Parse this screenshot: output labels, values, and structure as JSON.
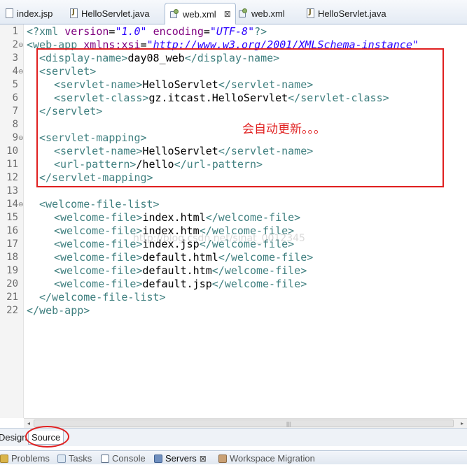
{
  "editor_tabs": [
    {
      "label": "index.jsp",
      "icon": "jsp-file-icon"
    },
    {
      "label": "HelloServlet.java",
      "icon": "java-file-icon"
    },
    {
      "label": "web.xml",
      "icon": "xml-file-icon",
      "active": true,
      "close": "⊠"
    },
    {
      "label": "web.xml",
      "icon": "xml-file-icon"
    },
    {
      "label": "HelloServlet.java",
      "icon": "java-file-icon"
    }
  ],
  "line_numbers": [
    "1",
    "2",
    "3",
    "4",
    "5",
    "6",
    "7",
    "8",
    "9",
    "10",
    "11",
    "12",
    "13",
    "14",
    "15",
    "16",
    "17",
    "18",
    "19",
    "20",
    "21",
    "22"
  ],
  "fold_markers": [
    "⊖",
    "⊖",
    "⊖",
    "⊖"
  ],
  "code": {
    "l1": {
      "a": "<?xml ",
      "b": "version",
      "c": "=",
      "d": "\"1.0\"",
      "e": " encoding",
      "f": "=",
      "g": "\"UTF-8\"",
      "h": "?>"
    },
    "l2": {
      "a": "<web-app ",
      "b": "xmlns:xsi",
      "c": "=",
      "d": "\"http://www.w3.org/2001/XMLSchema-instance\""
    },
    "l3": {
      "open": "<display-name>",
      "text": "day08_web",
      "close": "</display-name>"
    },
    "l4": {
      "open": "<servlet>"
    },
    "l5": {
      "open": "<servlet-name>",
      "text": "HelloServlet",
      "close": "</servlet-name>"
    },
    "l6": {
      "open": "<servlet-class>",
      "text": "gz.itcast.HelloServlet",
      "close": "</servlet-class>"
    },
    "l7": {
      "close": "</servlet>"
    },
    "l9": {
      "open": "<servlet-mapping>"
    },
    "l10": {
      "open": "<servlet-name>",
      "text": "HelloServlet",
      "close": "</servlet-name>"
    },
    "l11": {
      "open": "<url-pattern>",
      "text": "/hello",
      "close": "</url-pattern>"
    },
    "l12": {
      "close": "</servlet-mapping>"
    },
    "l14": {
      "open": "<welcome-file-list>"
    },
    "l15": {
      "open": "<welcome-file>",
      "text": "index.html",
      "close": "</welcome-file>"
    },
    "l16": {
      "open": "<welcome-file>",
      "text": "index.htm",
      "close": "</welcome-file>"
    },
    "l17": {
      "open": "<welcome-file>",
      "text": "index.jsp",
      "close": "</welcome-file>"
    },
    "l18": {
      "open": "<welcome-file>",
      "text": "default.html",
      "close": "</welcome-file>"
    },
    "l19": {
      "open": "<welcome-file>",
      "text": "default.htm",
      "close": "</welcome-file>"
    },
    "l20": {
      "open": "<welcome-file>",
      "text": "default.jsp",
      "close": "</welcome-file>"
    },
    "l21": {
      "close": "</welcome-file-list>"
    },
    "l22": {
      "close": "</web-app>"
    }
  },
  "annotation": "会自动更新。。。",
  "watermark": "http://blog.csdn.net/sinat_0012345",
  "scrollbar": {
    "left_arrow": "◂",
    "right_arrow": "▸",
    "grip": "|||"
  },
  "mode_tabs": {
    "design": "Design",
    "source": "Source"
  },
  "bottom_views": [
    {
      "label": "Problems",
      "icon": "problems-icon"
    },
    {
      "label": "Tasks",
      "icon": "tasks-icon"
    },
    {
      "label": "Console",
      "icon": "console-icon"
    },
    {
      "label": "Servers",
      "icon": "servers-icon",
      "active": true,
      "close": "⊠"
    },
    {
      "label": "Workspace Migration",
      "icon": "migration-icon"
    }
  ],
  "colors": {
    "annotation_red": "#e02020",
    "xml_tag": "#3f7f7f",
    "xml_attr": "#7f007f",
    "xml_value": "#2a00ff"
  }
}
